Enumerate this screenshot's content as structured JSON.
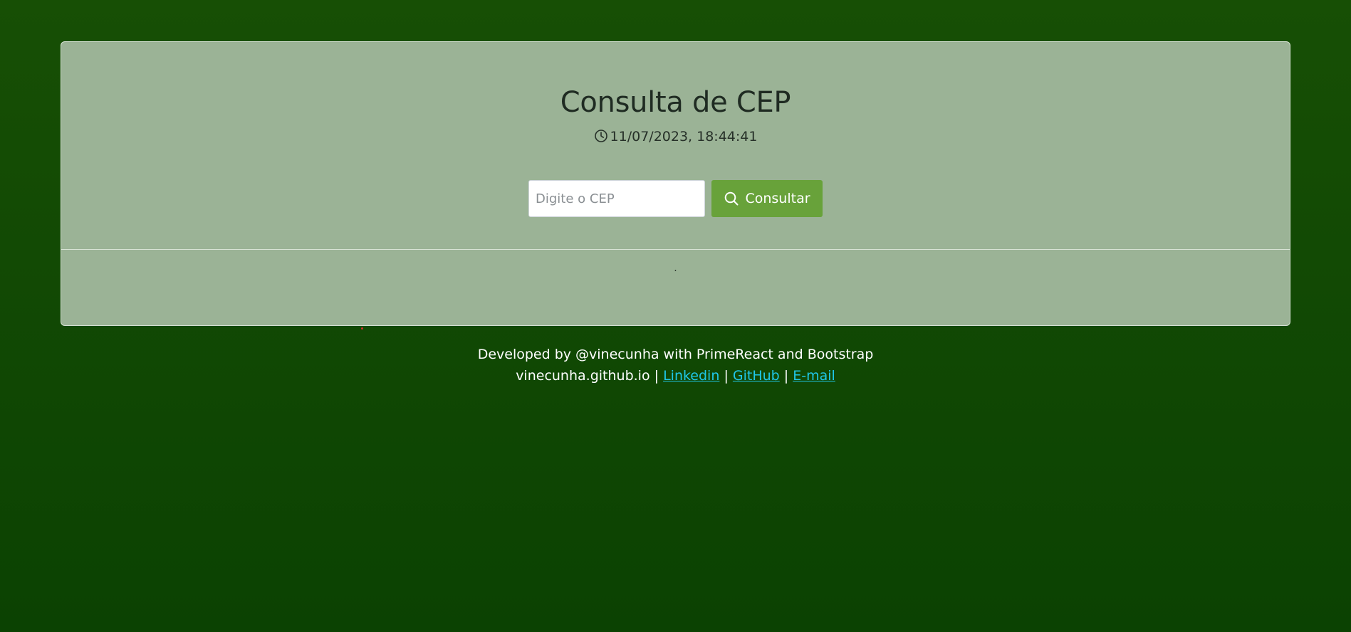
{
  "card": {
    "title": "Consulta de CEP",
    "datetime": "11/07/2023, 18:44:41",
    "clock_icon": "clock-icon",
    "search": {
      "placeholder": "Digite o CEP",
      "value": "",
      "button_label": "Consultar",
      "button_icon": "search-icon",
      "button_color": "#68a23a"
    },
    "result_text": "."
  },
  "footer": {
    "line1": "Developed by @vinecunha with PrimeReact and Bootstrap",
    "site": "vinecunha.github.io",
    "separator": "|",
    "links": {
      "linkedin": "Linkedin",
      "github": "GitHub",
      "email": "E-mail"
    },
    "link_color": "#1fc7e8"
  },
  "colors": {
    "background": "#174f05",
    "card_background": "#9bb396"
  }
}
